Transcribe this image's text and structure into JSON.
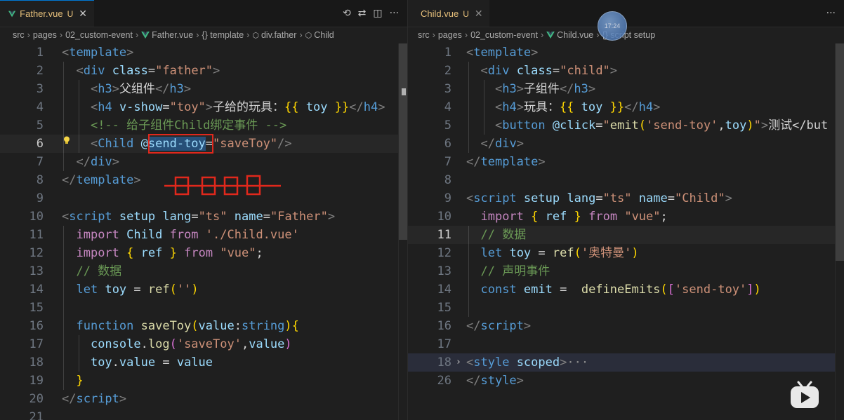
{
  "left": {
    "tab": {
      "name": "Father.vue",
      "status": "U",
      "close": "✕"
    },
    "actions": [
      "⟲",
      "⇄",
      "◫",
      "···"
    ],
    "breadcrumb": [
      "src",
      "pages",
      "02_custom-event",
      "Father.vue",
      "{} template",
      "div.father",
      "Child"
    ],
    "lines": [
      {
        "n": "1"
      },
      {
        "n": "2"
      },
      {
        "n": "3"
      },
      {
        "n": "4"
      },
      {
        "n": "5"
      },
      {
        "n": "6"
      },
      {
        "n": "7"
      },
      {
        "n": "8"
      },
      {
        "n": "9"
      },
      {
        "n": "10"
      },
      {
        "n": "11"
      },
      {
        "n": "12"
      },
      {
        "n": "13"
      },
      {
        "n": "14"
      },
      {
        "n": "15"
      },
      {
        "n": "16"
      },
      {
        "n": "17"
      },
      {
        "n": "18"
      },
      {
        "n": "19"
      },
      {
        "n": "20"
      },
      {
        "n": "21"
      }
    ],
    "code": {
      "l1": "template",
      "l2_tag": "div",
      "l2_attr": "class",
      "l2_val": "\"father\"",
      "l3_tag": "h3",
      "l3_text": "父组件",
      "l4_tag": "h4",
      "l4_attr": "v-show",
      "l4_val": "\"toy\"",
      "l4_text": "子给的玩具：",
      "l4_expr": "toy",
      "l5": "<!-- 给子组件Child绑定事件 -->",
      "l6_tag": "Child",
      "l6_event": "send-toy",
      "l6_val": "\"saveToy\"",
      "l7_tag": "div",
      "l8": "template",
      "l10_tag": "script",
      "l10_a1": "setup",
      "l10_a2": "lang",
      "l10_v2": "\"ts\"",
      "l10_a3": "name",
      "l10_v3": "\"Father\"",
      "l11_kw": "import",
      "l11_id": "Child",
      "l11_from": "from",
      "l11_src": "'./Child.vue'",
      "l12_kw": "import",
      "l12_id": "ref",
      "l12_from": "from",
      "l12_src": "\"vue\"",
      "l13": "// 数据",
      "l14_kw": "let",
      "l14_id": "toy",
      "l14_fn": "ref",
      "l14_arg": "''",
      "l16_kw": "function",
      "l16_fn": "saveToy",
      "l16_param": "value",
      "l16_type": "string",
      "l17_obj": "console",
      "l17_fn": "log",
      "l17_arg": "'saveToy'",
      "l17_arg2": "value",
      "l18_obj": "toy",
      "l18_prop": "value",
      "l18_rhs": "value",
      "l20": "script"
    }
  },
  "right": {
    "tab": {
      "name": "Child.vue",
      "status": "U",
      "close": "✕"
    },
    "actions": [
      "···"
    ],
    "breadcrumb": [
      "src",
      "pages",
      "02_custom-event",
      "Child.vue",
      "{} script setup"
    ],
    "clock": "17:24",
    "lines": [
      {
        "n": "1"
      },
      {
        "n": "2"
      },
      {
        "n": "3"
      },
      {
        "n": "4"
      },
      {
        "n": "5"
      },
      {
        "n": "6"
      },
      {
        "n": "7"
      },
      {
        "n": "8"
      },
      {
        "n": "9"
      },
      {
        "n": "10"
      },
      {
        "n": "11"
      },
      {
        "n": "12"
      },
      {
        "n": "13"
      },
      {
        "n": "14"
      },
      {
        "n": "15"
      },
      {
        "n": "16"
      },
      {
        "n": "17"
      },
      {
        "n": "18"
      },
      {
        "n": "26"
      }
    ],
    "code": {
      "l1": "template",
      "l2_tag": "div",
      "l2_attr": "class",
      "l2_val": "\"child\"",
      "l3_tag": "h3",
      "l3_text": "子组件",
      "l4_tag": "h4",
      "l4_text": "玩具：",
      "l4_expr": "toy",
      "l5_tag": "button",
      "l5_attr": "@click",
      "l5_fn": "emit",
      "l5_arg": "'send-toy'",
      "l5_arg2": "toy",
      "l5_text": "测试</but",
      "l6_tag": "div",
      "l7": "template",
      "l9_tag": "script",
      "l9_a1": "setup",
      "l9_a2": "lang",
      "l9_v2": "\"ts\"",
      "l9_a3": "name",
      "l9_v3": "\"Child\"",
      "l10_kw": "import",
      "l10_id": "ref",
      "l10_from": "from",
      "l10_src": "\"vue\"",
      "l11": "// 数据",
      "l12_kw": "let",
      "l12_id": "toy",
      "l12_fn": "ref",
      "l12_arg": "'奥特曼'",
      "l13": "// 声明事件",
      "l14_kw": "const",
      "l14_id": "emit",
      "l14_fn": "defineEmits",
      "l14_arg": "'send-toy'",
      "l16": "script",
      "l18_tag": "style",
      "l18_attr": "scoped",
      "l18_more": "···",
      "l26": "style"
    }
  }
}
